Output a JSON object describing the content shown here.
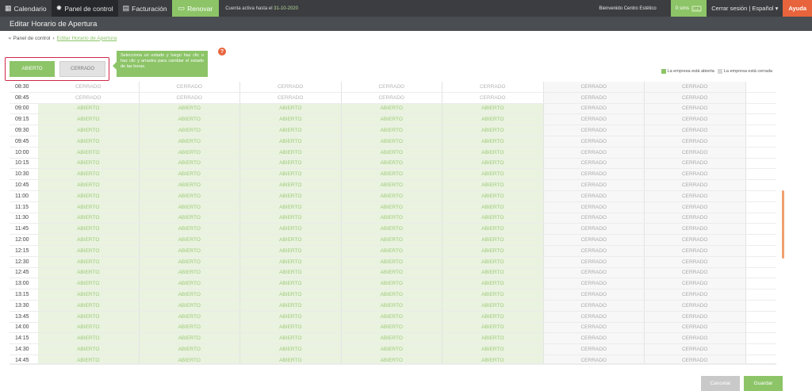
{
  "topbar": {
    "nav": [
      {
        "label": "Calendario",
        "icon": "calendar-icon",
        "glyph": "▦"
      },
      {
        "label": "Panel de control",
        "icon": "gear-icon",
        "glyph": "✹"
      },
      {
        "label": "Facturación",
        "icon": "invoice-icon",
        "glyph": "▤"
      }
    ],
    "renew": {
      "label": "Renovar",
      "icon": "credit-card-icon",
      "glyph": "▭"
    },
    "account_prefix": "Cuenta activa hasta el ",
    "account_date": "31-10-2020",
    "welcome": "Bienvenido Centro Estético",
    "zero_label": "0 sms",
    "zero_chip": "sms",
    "logout": "Cerrar sesión",
    "language": "Español",
    "help": "Ayuda"
  },
  "subheader": {
    "title": "Editar Horario de Apertura"
  },
  "breadcrumb": {
    "root": "Panel de control",
    "current": "Editar Horario de Apertura"
  },
  "state_selector": {
    "open_label": "ABIERTO",
    "closed_label": "CERRADO"
  },
  "tooltip": {
    "text": "Selecciona un estado y luego haz clic o haz clic y arrastra para cambiar el estado de las horas."
  },
  "help_icon": "?",
  "legend": {
    "open": "La empresa está abierta",
    "closed": "La empresa está cerrada"
  },
  "schedule": {
    "open_label": "ABIERTO",
    "closed_label": "CERRADO",
    "times": [
      "08:30",
      "08:45",
      "09:00",
      "09:15",
      "09:30",
      "09:45",
      "10:00",
      "10:15",
      "10:30",
      "10:45",
      "11:00",
      "11:15",
      "11:30",
      "11:45",
      "12:00",
      "12:15",
      "12:30",
      "12:45",
      "13:00",
      "13:15",
      "13:30",
      "13:45",
      "14:00",
      "14:15",
      "14:30",
      "14:45"
    ],
    "open_days": 5,
    "days_total": 7,
    "open_from_index": 2
  },
  "footer": {
    "cancel": "Cancelar",
    "save": "Guardar"
  }
}
